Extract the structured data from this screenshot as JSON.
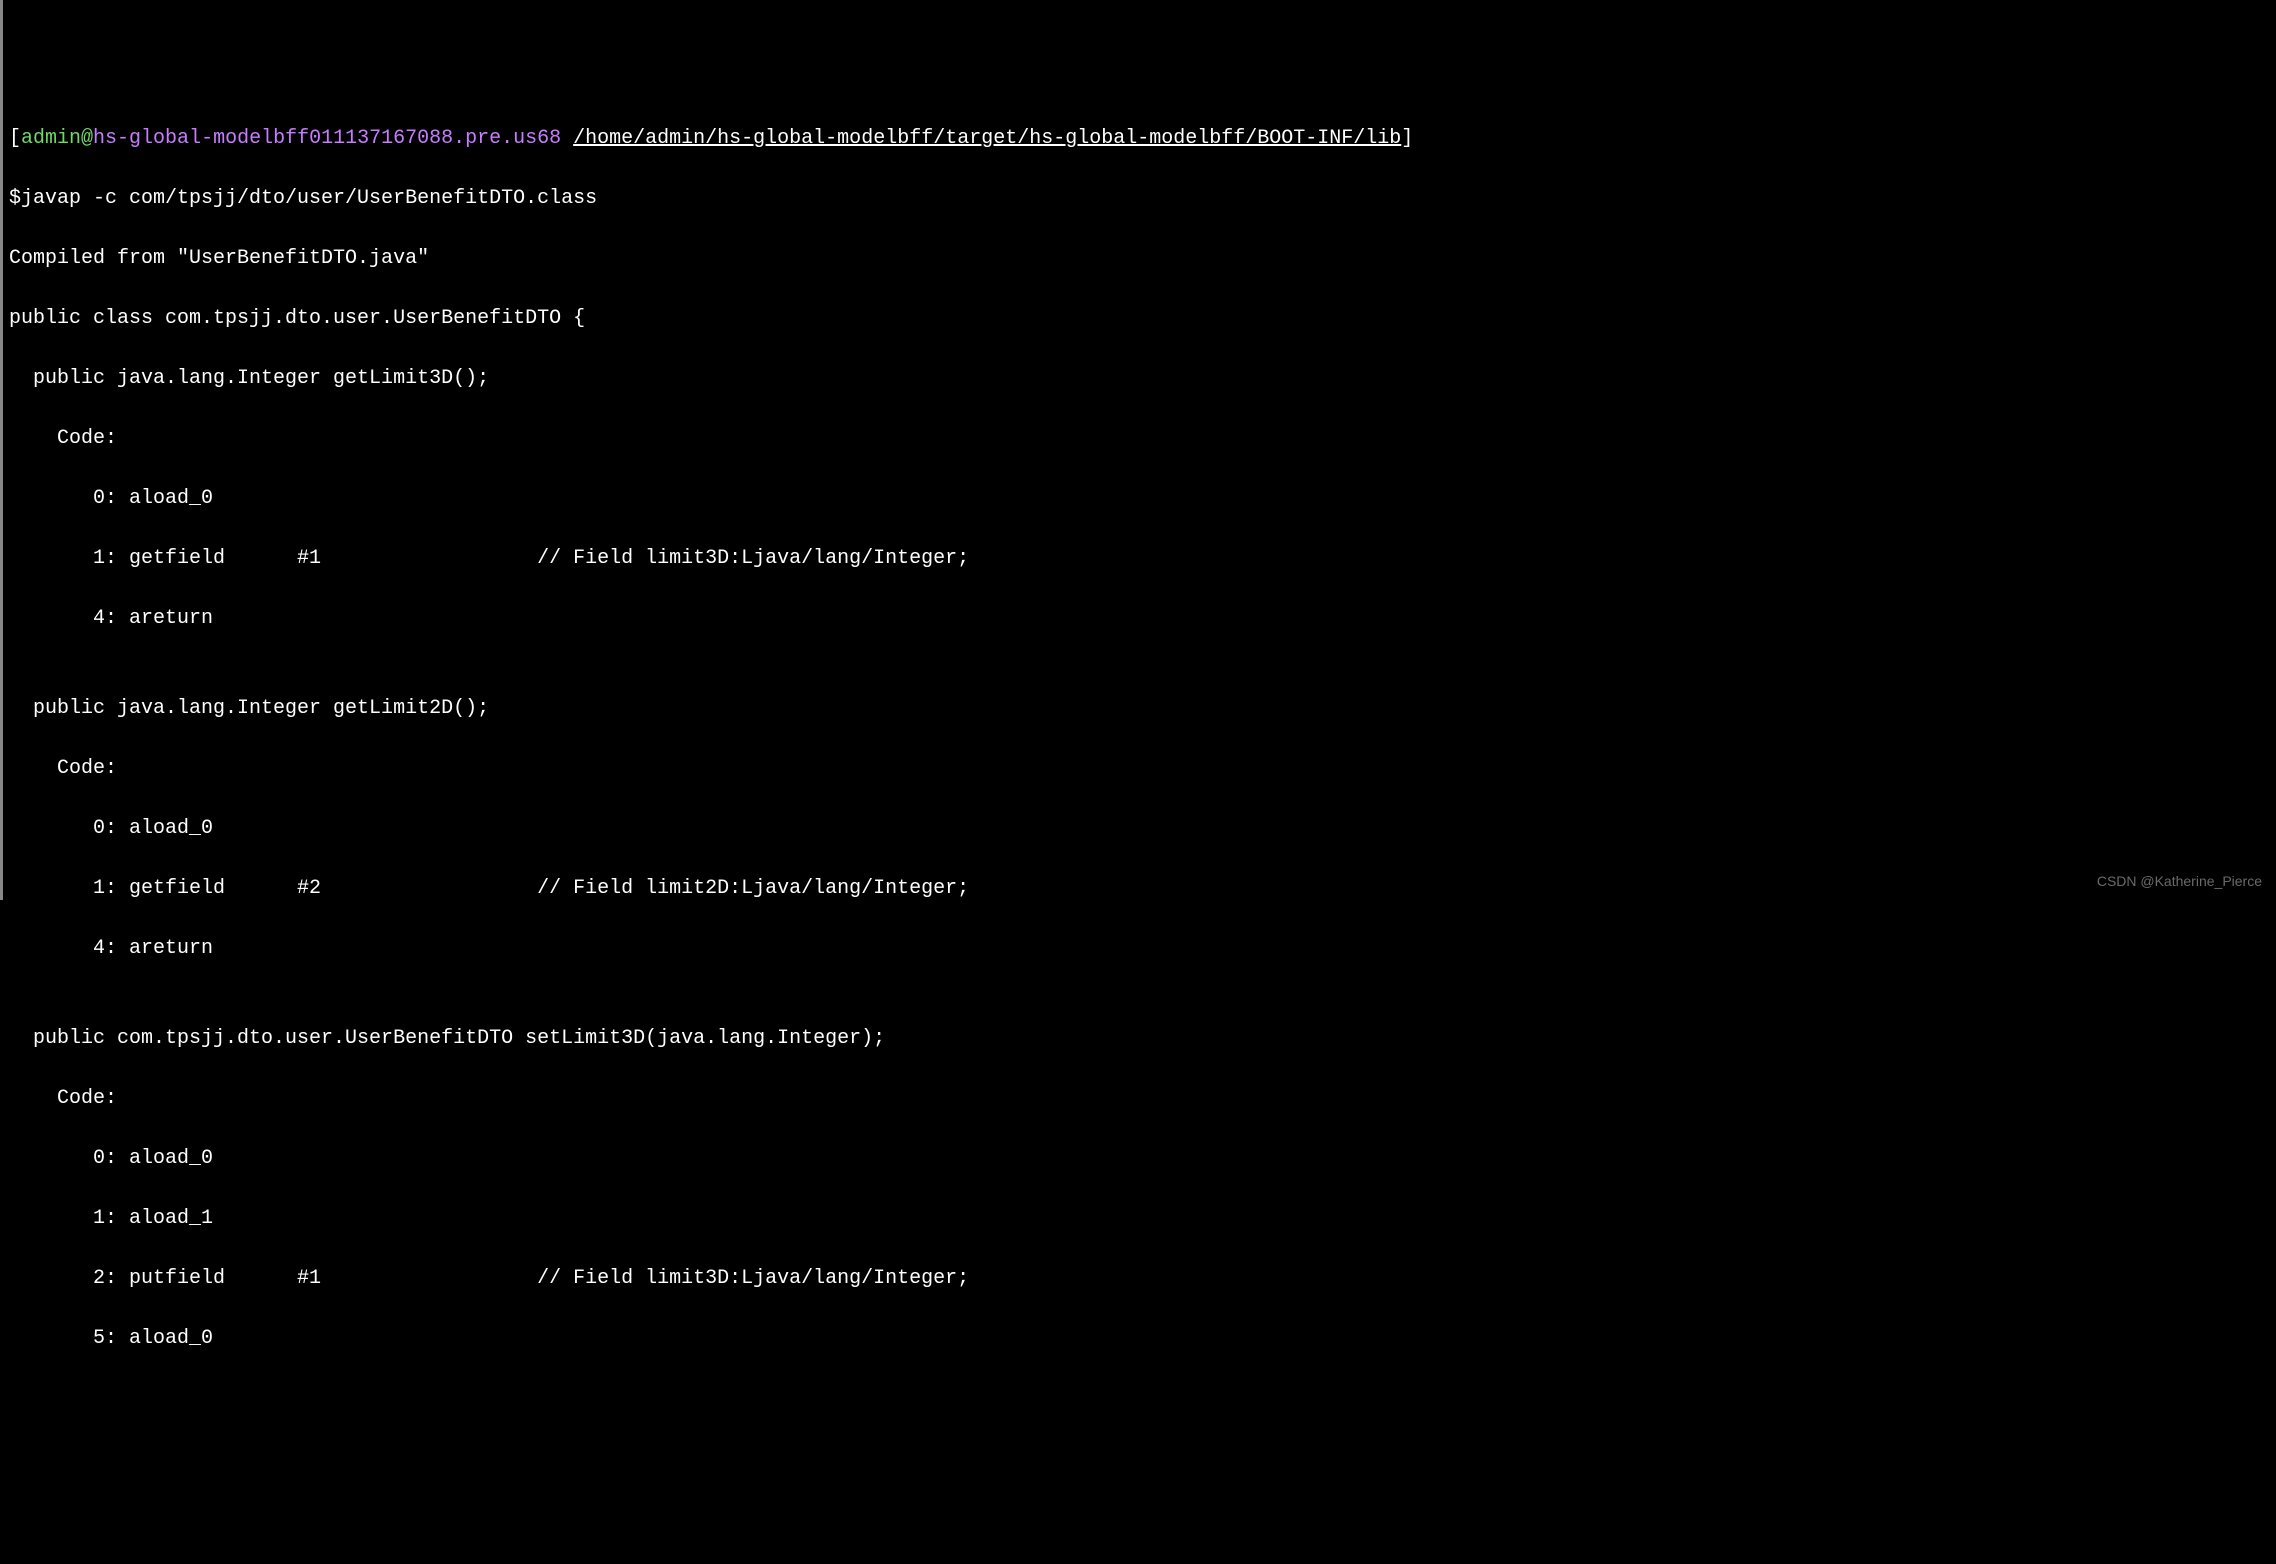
{
  "prompt": {
    "open_bracket": "[",
    "user": "admin",
    "at": "@",
    "host": "hs-global-modelbff011137167088.pre.us68",
    "space": " ",
    "path": "/home/admin/hs-global-modelbff/target/hs-global-modelbff/BOOT-INF/lib",
    "close_bracket": "]"
  },
  "command": "$javap -c com/tpsjj/dto/user/UserBenefitDTO.class",
  "output": {
    "l0": "Compiled from \"UserBenefitDTO.java\"",
    "l1": "public class com.tpsjj.dto.user.UserBenefitDTO {",
    "l2": "  public java.lang.Integer getLimit3D();",
    "l3": "    Code:",
    "l4": "       0: aload_0",
    "l5": "       1: getfield      #1                  // Field limit3D:Ljava/lang/Integer;",
    "l6": "       4: areturn",
    "l7": "",
    "l8": "  public java.lang.Integer getLimit2D();",
    "l9": "    Code:",
    "l10": "       0: aload_0",
    "l11": "       1: getfield      #2                  // Field limit2D:Ljava/lang/Integer;",
    "l12": "       4: areturn",
    "l13": "",
    "l14": "  public com.tpsjj.dto.user.UserBenefitDTO setLimit3D(java.lang.Integer);",
    "l15": "    Code:",
    "l16": "       0: aload_0",
    "l17": "       1: aload_1",
    "l18": "       2: putfield      #1                  // Field limit3D:Ljava/lang/Integer;",
    "l19": "       5: aload_0"
  },
  "watermark": "CSDN @Katherine_Pierce"
}
